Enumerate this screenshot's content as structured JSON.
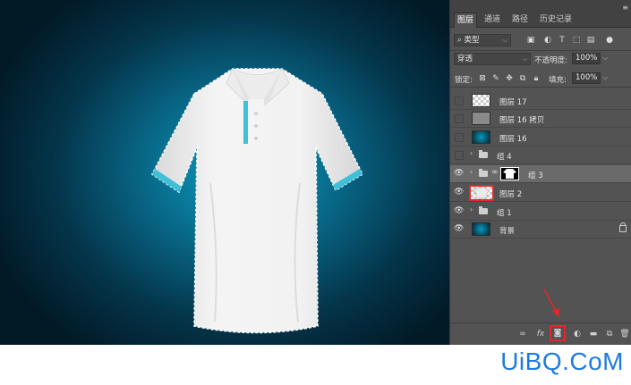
{
  "tabs": [
    "图层",
    "通道",
    "路径",
    "历史记录"
  ],
  "filter": {
    "kind": "类型"
  },
  "blend": {
    "mode": "穿透",
    "opacity_label": "不透明度:",
    "opacity_value": "100%"
  },
  "lock_row": {
    "lock_label": "锁定:",
    "fill_label": "填充:",
    "fill_value": "100%"
  },
  "layers": [
    {
      "name": "图层 17",
      "visible": false
    },
    {
      "name": "图层 16 拷贝",
      "visible": false
    },
    {
      "name": "图层 16",
      "visible": false
    },
    {
      "name": "组 4",
      "visible": false
    },
    {
      "name": "组 3",
      "visible": true,
      "selected": true
    },
    {
      "name": "图层 2",
      "visible": true
    },
    {
      "name": "组 1",
      "visible": true
    },
    {
      "name": "背景",
      "visible": true,
      "locked": true
    }
  ],
  "bottom": {
    "fx": "fx"
  },
  "watermark": "UiBQ.CoM",
  "colors": {
    "highlight": "#e8262b",
    "accent": "#3fc0d8",
    "watermark": "#1e7be0"
  }
}
